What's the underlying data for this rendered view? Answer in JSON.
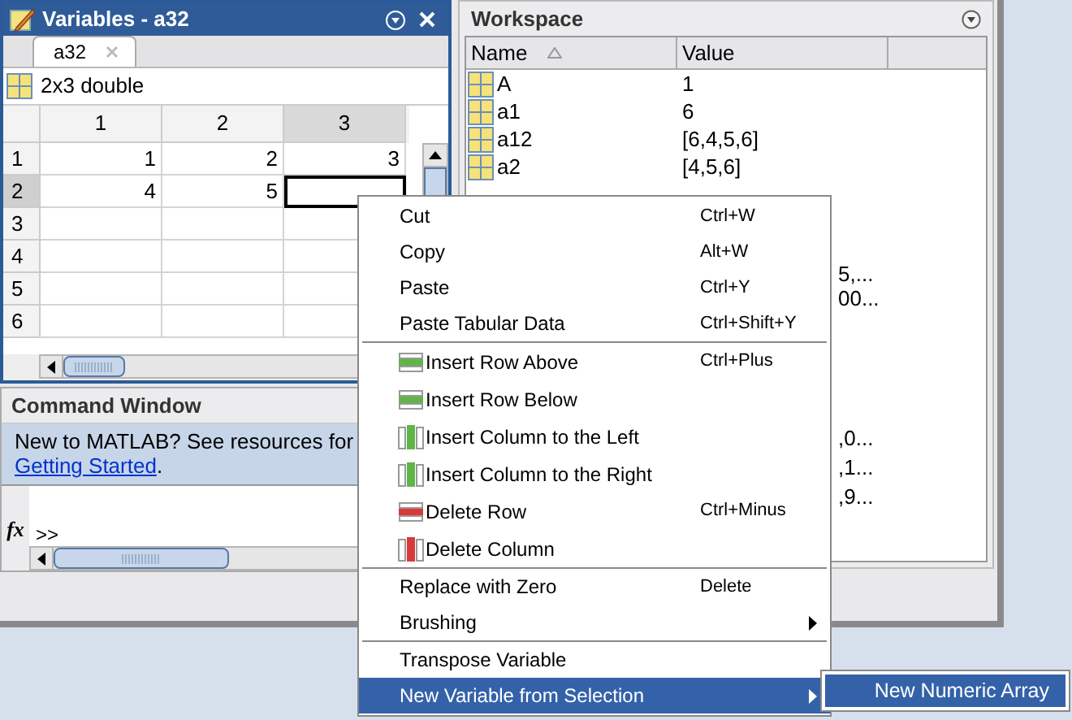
{
  "variables_panel": {
    "title": "Variables - a32",
    "tab": {
      "label": "a32",
      "selected": true
    },
    "info": "2x3 double",
    "columns": [
      {
        "label": "1",
        "selected": false
      },
      {
        "label": "2",
        "selected": false
      },
      {
        "label": "3",
        "selected": true
      }
    ],
    "rows": [
      {
        "label": "1",
        "selected": false,
        "cells": [
          {
            "text": "1",
            "selected": false
          },
          {
            "text": "2",
            "selected": false
          },
          {
            "text": "3",
            "selected": false
          }
        ]
      },
      {
        "label": "2",
        "selected": true,
        "cells": [
          {
            "text": "4",
            "selected": false
          },
          {
            "text": "5",
            "selected": false
          },
          {
            "selected": true
          }
        ]
      },
      {
        "label": "3",
        "selected": false,
        "cells": []
      },
      {
        "label": "4",
        "selected": false,
        "cells": []
      },
      {
        "label": "5",
        "selected": false,
        "cells": []
      },
      {
        "label": "6",
        "selected": false,
        "cells": []
      }
    ]
  },
  "command_window": {
    "title": "Command Window",
    "notice": "New to MATLAB? See resources for",
    "link": "Getting Started",
    "notice_end": ".",
    "function_symbol": "fx",
    "prompt": ">>"
  },
  "workspace": {
    "title": "Workspace",
    "columns": [
      "Name",
      "Value"
    ],
    "rows": [
      {
        "name": "A",
        "value": "1"
      },
      {
        "name": "a1",
        "value": "6"
      },
      {
        "name": "a12",
        "value": "[6,4,5,6]"
      },
      {
        "name": "a2",
        "value": "[4,5,6]"
      }
    ],
    "value_fragments_upper": [
      "5,...",
      "00..."
    ],
    "value_fragments_lower": [
      ",0...",
      ",1...",
      ",9..."
    ]
  },
  "context_menu": {
    "items": [
      {
        "kind": "item",
        "label": "Cut",
        "shortcut": "Ctrl+W",
        "submenu": false,
        "selected": false
      },
      {
        "kind": "item",
        "label": "Copy",
        "shortcut": "Alt+W",
        "submenu": false,
        "selected": false
      },
      {
        "kind": "item",
        "label": "Paste",
        "shortcut": "Ctrl+Y",
        "submenu": false,
        "selected": false
      },
      {
        "kind": "item",
        "label": "Paste Tabular Data",
        "shortcut": "Ctrl+Shift+Y",
        "submenu": false,
        "selected": false
      },
      {
        "kind": "separator"
      },
      {
        "kind": "insert_row",
        "label": "Insert Row Above",
        "shortcut": "Ctrl+Plus",
        "submenu": false,
        "selected": false
      },
      {
        "kind": "insert_row",
        "label": "Insert Row Below",
        "submenu": false,
        "selected": false
      },
      {
        "kind": "insert_column",
        "label": "Insert Column to the Left",
        "submenu": false,
        "selected": false
      },
      {
        "kind": "insert_column",
        "label": "Insert Column to the Right",
        "submenu": false,
        "selected": false
      },
      {
        "kind": "delete_row",
        "label": "Delete Row",
        "shortcut": "Ctrl+Minus",
        "submenu": false,
        "selected": false
      },
      {
        "kind": "delete_column",
        "label": "Delete Column",
        "submenu": false,
        "selected": false
      },
      {
        "kind": "separator"
      },
      {
        "kind": "item",
        "label": "Replace with Zero",
        "shortcut": "Delete",
        "submenu": false,
        "selected": false
      },
      {
        "kind": "item",
        "label": "Brushing",
        "submenu": true,
        "selected": false
      },
      {
        "kind": "separator"
      },
      {
        "kind": "item",
        "label": "Transpose Variable",
        "submenu": false,
        "selected": false
      },
      {
        "kind": "item",
        "label": "New Variable from Selection",
        "submenu": true,
        "selected": true
      }
    ],
    "submenu": [
      {
        "label": "New Numeric Array",
        "selected": true
      }
    ]
  }
}
